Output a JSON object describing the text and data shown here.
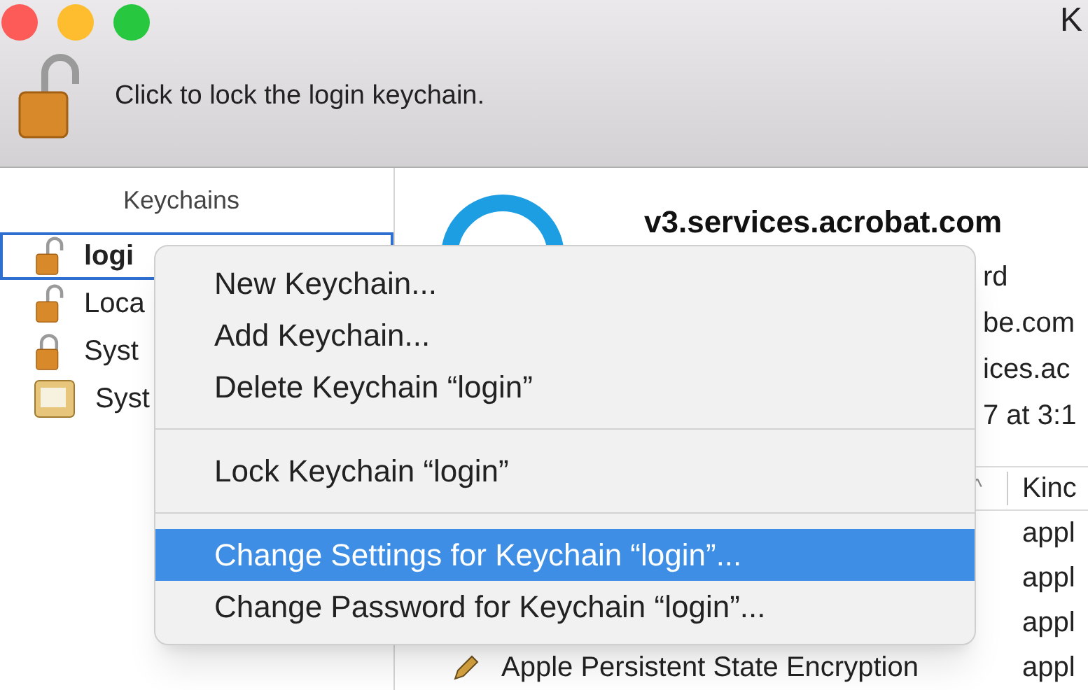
{
  "window": {
    "title": "K",
    "lock_message": "Click to lock the login keychain."
  },
  "sidebar": {
    "header": "Keychains",
    "items": [
      {
        "label": "logi",
        "selected": true,
        "locked": false,
        "kind": "lock"
      },
      {
        "label": "Loca",
        "selected": false,
        "locked": false,
        "kind": "lock"
      },
      {
        "label": "Syst",
        "selected": false,
        "locked": true,
        "kind": "lock"
      },
      {
        "label": "Syst",
        "selected": false,
        "kind": "certificate"
      }
    ]
  },
  "detail": {
    "title": "v3.services.acrobat.com",
    "lines": [
      "rd",
      "be.com",
      "ices.ac",
      "7 at 3:1"
    ]
  },
  "table": {
    "columns": [
      {
        "label": "^",
        "kind": "sort"
      },
      {
        "label": "Kinc",
        "kind": "text"
      }
    ],
    "rows": [
      {
        "kind_value": "appl"
      },
      {
        "kind_value": "appl"
      },
      {
        "kind_value": "appl"
      },
      {
        "name": "Apple Persistent State Encryption",
        "kind_value": "appl"
      }
    ]
  },
  "context_menu": [
    {
      "kind": "item",
      "label": "New Keychain...",
      "selected": false
    },
    {
      "kind": "item",
      "label": "Add Keychain...",
      "selected": false
    },
    {
      "kind": "item",
      "label": "Delete Keychain “login”",
      "selected": false
    },
    {
      "kind": "separator"
    },
    {
      "kind": "item",
      "label": "Lock Keychain “login”",
      "selected": false
    },
    {
      "kind": "separator"
    },
    {
      "kind": "item",
      "label": "Change Settings for Keychain “login”...",
      "selected": true
    },
    {
      "kind": "item",
      "label": "Change Password for Keychain “login”...",
      "selected": false
    }
  ]
}
